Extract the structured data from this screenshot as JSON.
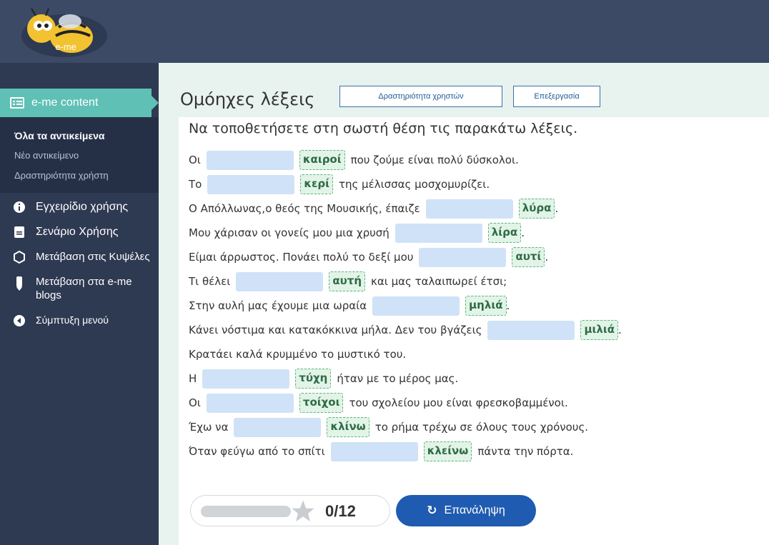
{
  "logo_text": "e-me",
  "sidebar": {
    "active_label": "e-me content",
    "submenu": [
      "Όλα τα αντικείμενα",
      "Νέο αντικείμενο",
      "Δραστηριότητα χρήστη"
    ],
    "items": [
      {
        "label": "Εγχειρίδιο χρήσης",
        "icon": "info-icon"
      },
      {
        "label": "Σενάριο Χρήσης",
        "icon": "document-icon"
      },
      {
        "label": "Μετάβαση στις Κυψέλες",
        "icon": "hexagon-icon"
      },
      {
        "label": "Μετάβαση στα e-me blogs",
        "icon": "pencil-icon"
      },
      {
        "label": "Σύμπτυξη μενού",
        "icon": "collapse-icon"
      }
    ]
  },
  "header": {
    "title": "Ομόηχες λέξεις",
    "user_activity_button": "Δραστηριότητα χρηστών",
    "edit_button": "Επεξεργασία"
  },
  "exercise": {
    "instruction": "Να τοποθετήσετε στη σωστή θέση τις παρακάτω λέξεις.",
    "lines": [
      {
        "pre": "Οι",
        "word": "καιροί",
        "post": "που ζούμε είναι πολύ δύσκολοι."
      },
      {
        "pre": "Το",
        "word": "κερί",
        "post": "της μέλισσας μοσχομυρίζει."
      },
      {
        "pre": "Ο Απόλλωνας,ο θεός της Μουσικής, έπαιζε",
        "word": "λύρα",
        "post": "."
      },
      {
        "pre": "Μου χάρισαν οι γονείς μου μια χρυσή",
        "word": "λίρα",
        "post": "."
      },
      {
        "pre": "Είμαι άρρωστος. Πονάει πολύ το δεξί μου",
        "word": "αυτί",
        "post": "."
      },
      {
        "pre": "Τι θέλει",
        "word": "αυτή",
        "post": "και μας ταλαιπωρεί έτσι;"
      },
      {
        "pre": "Στην αυλή μας έχουμε μια ωραία",
        "word": "μηλιά",
        "post": "."
      },
      {
        "pre": "Κάνει νόστιμα και κατακόκκινα μήλα. Δεν του βγάζεις",
        "word": "μιλιά",
        "post": "."
      },
      {
        "text": "Κρατάει καλά κρυμμένο το μυστικό του."
      },
      {
        "pre": "Η",
        "word": "τύχη",
        "post": "ήταν με το μέρος μας."
      },
      {
        "pre": "Οι",
        "word": "τοίχοι",
        "post": "του σχολείου μου είναι φρεσκοβαμμένοι."
      },
      {
        "pre": "Έχω να",
        "word": "κλίνω",
        "post": "το ρήμα τρέχω σε όλους τους χρόνους."
      },
      {
        "pre": "Όταν φεύγω από το σπίτι",
        "word": "κλείνω",
        "post": "πάντα την πόρτα."
      }
    ],
    "score": "0/12",
    "progress_fraction": 0,
    "retry_label": "Επανάληψη",
    "colors": {
      "blank": "#d0e2f7",
      "word_border": "#5cb57d",
      "retry": "#1f5bb0",
      "active": "#5fc0b5"
    }
  }
}
